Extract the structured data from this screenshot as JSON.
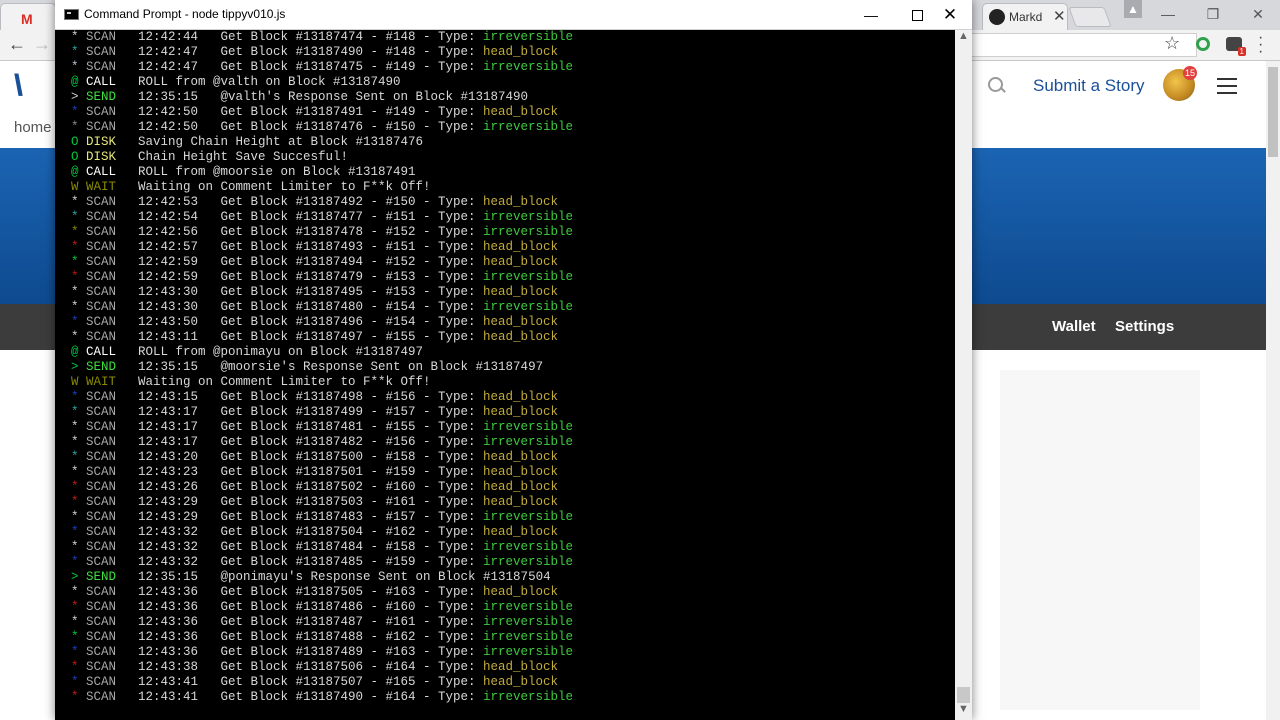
{
  "browser": {
    "tab_gmail_icon": "M",
    "tab_github_title": "Markd",
    "tab_github_close": "✕",
    "profile_icon": "▲",
    "window_minimize": "—",
    "window_restore": "❐",
    "window_close": "✕",
    "back": "←",
    "forward": "→",
    "star": "☆",
    "ext_badge": "1"
  },
  "site": {
    "logo": "\\\\\\",
    "submit_story": "Submit a Story",
    "notifications": "15",
    "home": "home",
    "nav_wallet": "Wallet",
    "nav_settings": "Settings"
  },
  "console": {
    "title": "Command Prompt - node  tippyv010.js",
    "minimize": "—",
    "close": "✕",
    "scroll_up": "▲",
    "scroll_down": "▼",
    "lines": [
      {
        "sym": "*",
        "tag": "SCAN",
        "msg": "12:42:44   Get Block #13187474 - #148 - Type:",
        "type": "irreversible"
      },
      {
        "sym": "*",
        "tag": "SCAN",
        "msg": "12:42:47   Get Block #13187490 - #148 - Type:",
        "type": "head_block"
      },
      {
        "sym": "*",
        "tag": "SCAN",
        "msg": "12:42:47   Get Block #13187475 - #149 - Type:",
        "type": "irreversible"
      },
      {
        "sym": "@",
        "tag": "CALL",
        "msg": "ROLL from @valth on Block #13187490",
        "type": ""
      },
      {
        "sym": ">",
        "tag": "SEND",
        "msg": "12:35:15   @valth's Response Sent on Block #13187490",
        "type": ""
      },
      {
        "sym": "*",
        "tag": "SCAN",
        "msg": "12:42:50   Get Block #13187491 - #149 - Type:",
        "type": "head_block"
      },
      {
        "sym": "*",
        "tag": "SCAN",
        "msg": "12:42:50   Get Block #13187476 - #150 - Type:",
        "type": "irreversible"
      },
      {
        "sym": "O",
        "tag": "DISK",
        "msg": "Saving Chain Height at Block #13187476",
        "type": ""
      },
      {
        "sym": "O",
        "tag": "DISK",
        "msg": "Chain Height Save Succesful!",
        "type": ""
      },
      {
        "sym": "@",
        "tag": "CALL",
        "msg": "ROLL from @moorsie on Block #13187491",
        "type": ""
      },
      {
        "sym": "W",
        "tag": "WAIT",
        "msg": "Waiting on Comment Limiter to F**k Off!",
        "type": ""
      },
      {
        "sym": "*",
        "tag": "SCAN",
        "msg": "12:42:53   Get Block #13187492 - #150 - Type:",
        "type": "head_block"
      },
      {
        "sym": "*",
        "tag": "SCAN",
        "msg": "12:42:54   Get Block #13187477 - #151 - Type:",
        "type": "irreversible"
      },
      {
        "sym": "*",
        "tag": "SCAN",
        "msg": "12:42:56   Get Block #13187478 - #152 - Type:",
        "type": "irreversible"
      },
      {
        "sym": "*",
        "tag": "SCAN",
        "msg": "12:42:57   Get Block #13187493 - #151 - Type:",
        "type": "head_block"
      },
      {
        "sym": "*",
        "tag": "SCAN",
        "msg": "12:42:59   Get Block #13187494 - #152 - Type:",
        "type": "head_block"
      },
      {
        "sym": "*",
        "tag": "SCAN",
        "msg": "12:42:59   Get Block #13187479 - #153 - Type:",
        "type": "irreversible"
      },
      {
        "sym": "*",
        "tag": "SCAN",
        "msg": "12:43:30   Get Block #13187495 - #153 - Type:",
        "type": "head_block"
      },
      {
        "sym": "*",
        "tag": "SCAN",
        "msg": "12:43:30   Get Block #13187480 - #154 - Type:",
        "type": "irreversible"
      },
      {
        "sym": "*",
        "tag": "SCAN",
        "msg": "12:43:50   Get Block #13187496 - #154 - Type:",
        "type": "head_block"
      },
      {
        "sym": "*",
        "tag": "SCAN",
        "msg": "12:43:11   Get Block #13187497 - #155 - Type:",
        "type": "head_block"
      },
      {
        "sym": "@",
        "tag": "CALL",
        "msg": "ROLL from @ponimayu on Block #13187497",
        "type": ""
      },
      {
        "sym": ">",
        "tag": "SEND",
        "msg": "12:35:15   @moorsie's Response Sent on Block #13187497",
        "type": ""
      },
      {
        "sym": "W",
        "tag": "WAIT",
        "msg": "Waiting on Comment Limiter to F**k Off!",
        "type": ""
      },
      {
        "sym": "*",
        "tag": "SCAN",
        "msg": "12:43:15   Get Block #13187498 - #156 - Type:",
        "type": "head_block"
      },
      {
        "sym": "*",
        "tag": "SCAN",
        "msg": "12:43:17   Get Block #13187499 - #157 - Type:",
        "type": "head_block"
      },
      {
        "sym": "*",
        "tag": "SCAN",
        "msg": "12:43:17   Get Block #13187481 - #155 - Type:",
        "type": "irreversible"
      },
      {
        "sym": "*",
        "tag": "SCAN",
        "msg": "12:43:17   Get Block #13187482 - #156 - Type:",
        "type": "irreversible"
      },
      {
        "sym": "*",
        "tag": "SCAN",
        "msg": "12:43:20   Get Block #13187500 - #158 - Type:",
        "type": "head_block"
      },
      {
        "sym": "*",
        "tag": "SCAN",
        "msg": "12:43:23   Get Block #13187501 - #159 - Type:",
        "type": "head_block"
      },
      {
        "sym": "*",
        "tag": "SCAN",
        "msg": "12:43:26   Get Block #13187502 - #160 - Type:",
        "type": "head_block"
      },
      {
        "sym": "*",
        "tag": "SCAN",
        "msg": "12:43:29   Get Block #13187503 - #161 - Type:",
        "type": "head_block"
      },
      {
        "sym": "*",
        "tag": "SCAN",
        "msg": "12:43:29   Get Block #13187483 - #157 - Type:",
        "type": "irreversible"
      },
      {
        "sym": "*",
        "tag": "SCAN",
        "msg": "12:43:32   Get Block #13187504 - #162 - Type:",
        "type": "head_block"
      },
      {
        "sym": "*",
        "tag": "SCAN",
        "msg": "12:43:32   Get Block #13187484 - #158 - Type:",
        "type": "irreversible"
      },
      {
        "sym": "*",
        "tag": "SCAN",
        "msg": "12:43:32   Get Block #13187485 - #159 - Type:",
        "type": "irreversible"
      },
      {
        "sym": ">",
        "tag": "SEND",
        "msg": "12:35:15   @ponimayu's Response Sent on Block #13187504",
        "type": ""
      },
      {
        "sym": "*",
        "tag": "SCAN",
        "msg": "12:43:36   Get Block #13187505 - #163 - Type:",
        "type": "head_block"
      },
      {
        "sym": "*",
        "tag": "SCAN",
        "msg": "12:43:36   Get Block #13187486 - #160 - Type:",
        "type": "irreversible"
      },
      {
        "sym": "*",
        "tag": "SCAN",
        "msg": "12:43:36   Get Block #13187487 - #161 - Type:",
        "type": "irreversible"
      },
      {
        "sym": "*",
        "tag": "SCAN",
        "msg": "12:43:36   Get Block #13187488 - #162 - Type:",
        "type": "irreversible"
      },
      {
        "sym": "*",
        "tag": "SCAN",
        "msg": "12:43:36   Get Block #13187489 - #163 - Type:",
        "type": "irreversible"
      },
      {
        "sym": "*",
        "tag": "SCAN",
        "msg": "12:43:38   Get Block #13187506 - #164 - Type:",
        "type": "head_block"
      },
      {
        "sym": "*",
        "tag": "SCAN",
        "msg": "12:43:41   Get Block #13187507 - #165 - Type:",
        "type": "head_block"
      },
      {
        "sym": "*",
        "tag": "SCAN",
        "msg": "12:43:41   Get Block #13187490 - #164 - Type:",
        "type": "irreversible"
      }
    ],
    "sym_colors": [
      "#d0d0d0",
      "#2ba3a8",
      "#b8c2d0",
      "#00c83c",
      "#d0d0d0",
      "#1a3fc0",
      "#8a8a8a",
      "#00c83c",
      "#00c83c",
      "#00c83c",
      "#8a8a00",
      "#d0d0d0",
      "#2ba3a8",
      "#8a8a00",
      "#c01a1a",
      "#00c83c",
      "#c01a1a",
      "#d0d0d0",
      "#d0d0d0",
      "#1a3fc0",
      "#d0d0d0",
      "#00c83c",
      "#00c83c",
      "#8a8a00",
      "#1a3fc0",
      "#2ba3a8",
      "#d0d0d0",
      "#d0d0d0",
      "#2ba3a8",
      "#d0d0d0",
      "#c01a1a",
      "#c01a1a",
      "#d0d0d0",
      "#1a3fc0",
      "#d0d0d0",
      "#1a3fc0",
      "#00c83c",
      "#d0d0d0",
      "#c01a1a",
      "#d0d0d0",
      "#00c83c",
      "#1a3fc0",
      "#c01a1a",
      "#1a3fc0",
      "#c01a1a"
    ],
    "tag_colors": {
      "SCAN": "#a8a8a8",
      "CALL": "#ffffff",
      "SEND": "#3ee03e",
      "DISK": "#e8e87a",
      "WAIT": "#8a8a00"
    },
    "type_colors": {
      "head_block": "#c2ac3a",
      "irreversible": "#3ec93e"
    }
  }
}
